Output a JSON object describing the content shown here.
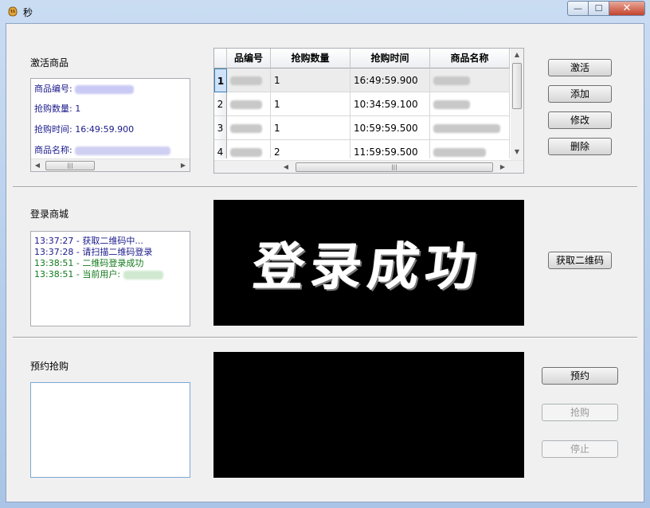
{
  "window": {
    "title": "秒",
    "close_glyph": "✕",
    "maximize_glyph": "☐",
    "minimize_glyph": "—"
  },
  "activate": {
    "section_label": "激活商品",
    "info": {
      "id_label": "商品编号:",
      "qty_label": "抢购数量:",
      "qty_value": "1",
      "time_label": "抢购时间:",
      "time_value": "16:49:59.900",
      "name_label": "商品名称:"
    },
    "buttons": {
      "activate": "激活",
      "add": "添加",
      "edit": "修改",
      "delete": "删除"
    },
    "table": {
      "headers": [
        "品编号",
        "抢购数量",
        "抢购时间",
        "商品名称"
      ],
      "rows": [
        {
          "num": "1",
          "qty": "1",
          "time": "16:49:59.900"
        },
        {
          "num": "2",
          "qty": "1",
          "time": "10:34:59.100"
        },
        {
          "num": "3",
          "qty": "1",
          "time": "10:59:59.500"
        },
        {
          "num": "4",
          "qty": "2",
          "time": "11:59:59.500"
        }
      ],
      "selected_row": 1
    }
  },
  "login": {
    "section_label": "登录商城",
    "log": [
      {
        "time": "13:37:27",
        "text": " - 获取二维码中...",
        "color": "#1a1a8c"
      },
      {
        "time": "13:37:28",
        "text": " - 请扫描二维码登录",
        "color": "#1a1a8c"
      },
      {
        "time": "13:38:51",
        "text": " - 二维码登录成功",
        "color": "#117a1a"
      },
      {
        "time": "13:38:51",
        "text": " - 当前用户:",
        "color": "#117a1a"
      }
    ],
    "banner_text": "登录成功",
    "get_qr_button": "获取二维码"
  },
  "reserve": {
    "section_label": "预约抢购",
    "buttons": {
      "reserve": "预约",
      "buy": "抢购",
      "stop": "停止"
    }
  }
}
